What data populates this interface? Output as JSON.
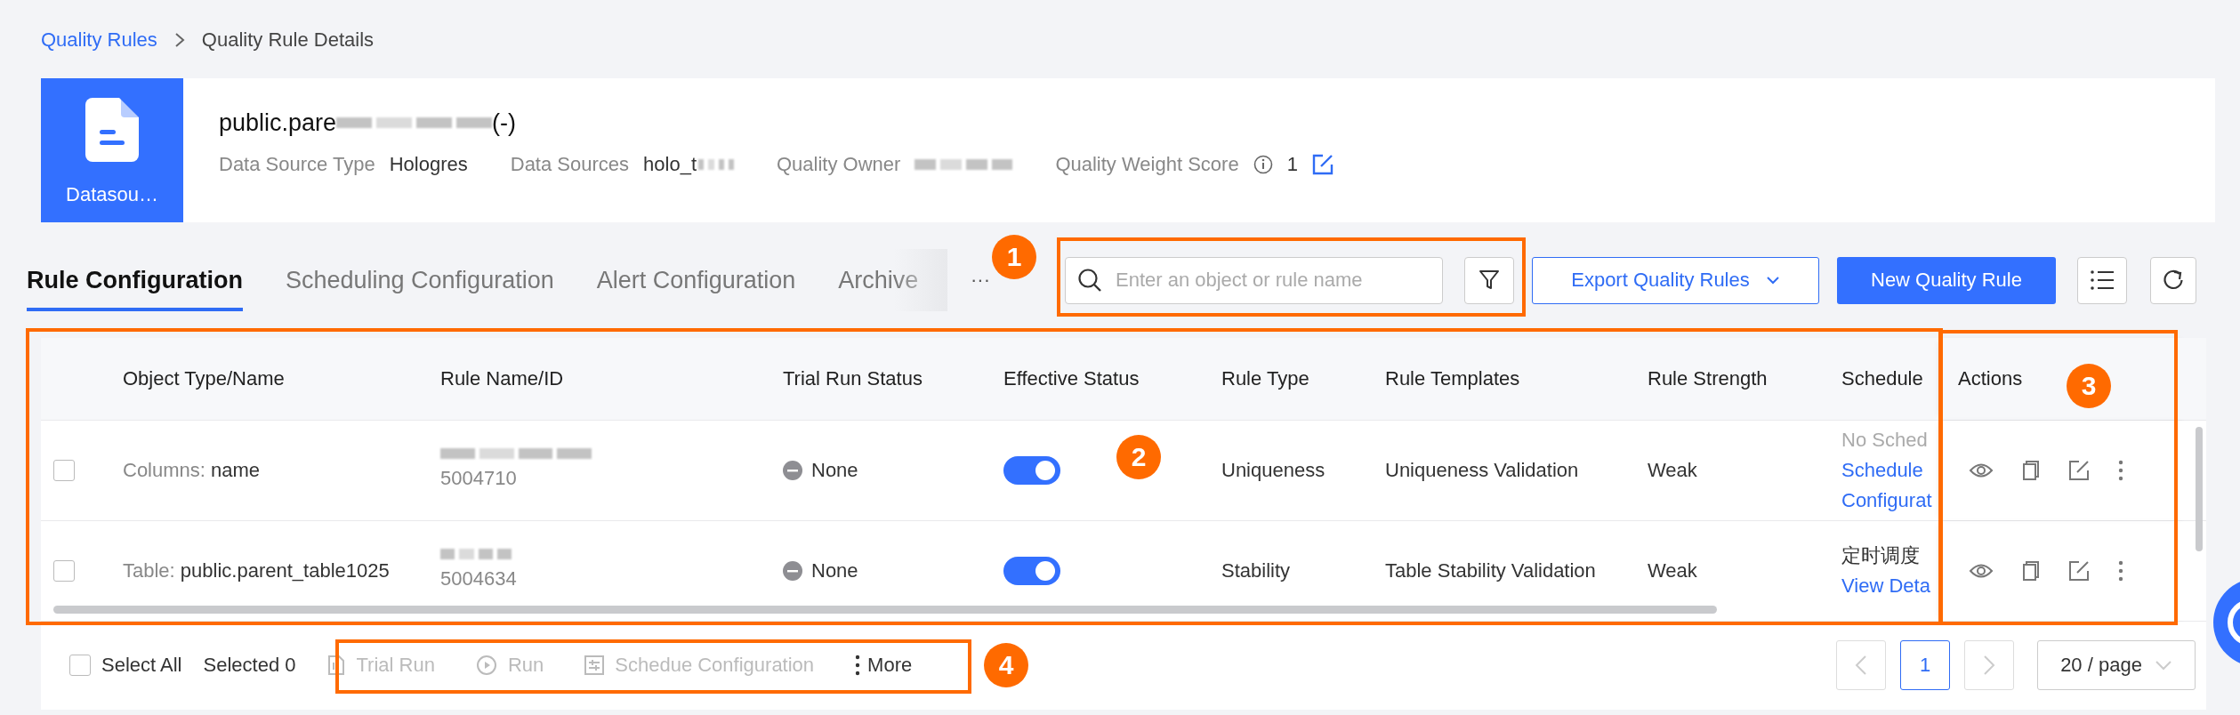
{
  "breadcrumb": [
    {
      "label": "Quality Rules",
      "kind": "link"
    },
    {
      "label": "Quality Rule Details",
      "kind": "current"
    }
  ],
  "header": {
    "tile_label": "Datasou…",
    "title_start": "public.pare",
    "title_end": "(-)",
    "meta": [
      {
        "label": "Data Source Type",
        "value": "Hologres",
        "kind": "text"
      },
      {
        "label": "Data Sources",
        "value": "holo_t",
        "kind": "partly_blurred"
      },
      {
        "label": "Quality Owner",
        "kind": "blurred"
      },
      {
        "label": "Quality Weight Score",
        "value": "1",
        "kind": "score"
      }
    ]
  },
  "tabs": [
    {
      "label": "Rule Configuration",
      "selected": true
    },
    {
      "label": "Scheduling Configuration",
      "selected": false
    },
    {
      "label": "Alert Configuration",
      "selected": false
    },
    {
      "label": "Archive",
      "selected": false
    }
  ],
  "tabs_more": "···",
  "toolbar": {
    "search": {
      "placeholder": "Enter an object or rule name"
    },
    "export_button": "Export Quality Rules",
    "new_button": "New Quality Rule"
  },
  "table": {
    "columns": [
      "Object Type/Name",
      "Rule Name/ID",
      "Trial Run Status",
      "Effective Status",
      "Rule Type",
      "Rule Templates",
      "Rule Strength",
      "Schedule",
      "Actions"
    ],
    "rows": [
      {
        "checked": false,
        "object_type": "Columns:",
        "object_name": "name",
        "rule_id": "5004710",
        "trial_status": "None",
        "effective_on": true,
        "rule_type": "Uniqueness",
        "template": "Uniqueness Validation",
        "strength": "Weak",
        "schedule": [
          {
            "text": "No Sched",
            "kind": "muted"
          },
          {
            "text": "Schedule Configurat",
            "kind": "link"
          }
        ]
      },
      {
        "checked": false,
        "object_type": "Table:",
        "object_name": "public.parent_table1025",
        "rule_id": "5004634",
        "trial_status": "None",
        "effective_on": true,
        "rule_type": "Stability",
        "template": "Table Stability Validation",
        "strength": "Weak",
        "schedule": [
          {
            "text": "定时调度",
            "kind": "text"
          },
          {
            "text": "View Deta",
            "kind": "link"
          }
        ]
      }
    ]
  },
  "footer": {
    "select_all": {
      "label": "Select All",
      "checked": false
    },
    "selected_count": "Selected 0",
    "batch_actions": [
      {
        "label": "Trial Run",
        "kind": "trial_run",
        "disabled": true
      },
      {
        "label": "Run",
        "kind": "run",
        "disabled": true
      },
      {
        "label": "Schedue Configuration",
        "kind": "schedule",
        "disabled": true
      },
      {
        "label": "More",
        "kind": "more",
        "disabled": false
      }
    ],
    "pagination": {
      "prev_disabled": true,
      "pages": [
        {
          "label": "1",
          "selected": true
        }
      ],
      "next_disabled": true,
      "page_size": "20 / page"
    }
  },
  "callouts": [
    {
      "number": "1"
    },
    {
      "number": "2"
    },
    {
      "number": "3"
    },
    {
      "number": "4"
    }
  ]
}
